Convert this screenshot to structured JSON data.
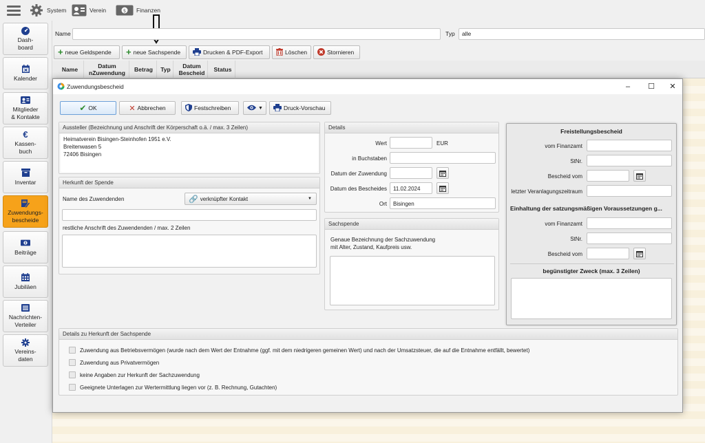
{
  "topbar": {
    "system": "System",
    "verein": "Verein",
    "finanzen": "Finanzen"
  },
  "sidebar": {
    "items": [
      {
        "label": "Dash-\nboard",
        "icon": "dashboard-icon"
      },
      {
        "label": "Kalender",
        "icon": "calendar-icon"
      },
      {
        "label": "Mitglieder\n& Kontakte",
        "icon": "contact-card-icon"
      },
      {
        "label": "Kassen-\nbuch",
        "icon": "euro-icon"
      },
      {
        "label": "Inventar",
        "icon": "inventory-icon"
      },
      {
        "label": "Zuwendungs-\nbescheide",
        "icon": "certificate-icon"
      },
      {
        "label": "Beiträge",
        "icon": "money-icon"
      },
      {
        "label": "Jubiläen",
        "icon": "calendar-grid-icon"
      },
      {
        "label": "Nachrichten-\nVerteiler",
        "icon": "mail-icon"
      },
      {
        "label": "Vereins-\ndaten",
        "icon": "gear-icon"
      }
    ],
    "active_index": 5
  },
  "filter": {
    "name_label": "Name",
    "name_value": "",
    "typ_label": "Typ",
    "typ_value": "alle"
  },
  "toolbar": {
    "neue_geldspende": "neue Geldspende",
    "neue_sachspende": "neue Sachspende",
    "drucken": "Drucken & PDF-Export",
    "loeschen": "Löschen",
    "stornieren": "Stornieren"
  },
  "table": {
    "headers": [
      "Name",
      "Datum nZuwendung",
      "Betrag",
      "Typ",
      "Datum Bescheid",
      "Status"
    ]
  },
  "dialog": {
    "title": "Zuwendungsbescheid",
    "buttons": {
      "ok": "OK",
      "abbrechen": "Abbrechen",
      "festschreiben": "Festschreiben",
      "druckvorschau": "Druck-Vorschau"
    },
    "aussteller": {
      "header": "Aussteller (Bezeichnung und Anschrift der Körperschaft o.ä. / max. 3 Zeilen)",
      "line1": "Heimatverein Bisingen-Steinhofen 1951 e.V.",
      "line2": "Breitenwasen 5",
      "line3": "72406 Bisingen"
    },
    "herkunft": {
      "header": "Herkunft der Spende",
      "name_label": "Name des Zuwendenden",
      "contact_button": "verknüpfter Kontakt",
      "name_value": "",
      "anschrift_label": "restliche Anschrift des Zuwendenden / max. 2 Zeilen",
      "anschrift_value": ""
    },
    "details": {
      "header": "Details",
      "wert_label": "Wert",
      "wert_value": "",
      "currency": "EUR",
      "buchstaben_label": "in Buchstaben",
      "buchstaben_value": "",
      "datum_zuwendung_label": "Datum der Zuwendung",
      "datum_zuwendung_value": "",
      "datum_bescheid_label": "Datum des Bescheides",
      "datum_bescheid_value": "11.02.2024",
      "ort_label": "Ort",
      "ort_value": "Bisingen"
    },
    "sachspende": {
      "header": "Sachspende",
      "desc1": "Genaue Bezeichnung der Sachzuwendung",
      "desc2": "mit Alter, Zustand, Kaufpreis usw.",
      "value": ""
    },
    "freistellung": {
      "header": "Freistellungsbescheid",
      "finanzamt_label": "vom Finanzamt",
      "stnr_label": "StNr.",
      "bescheid_label": "Bescheid vom",
      "zeitraum_label": "letzter Veranlagungszeitraum",
      "satzung_header": "Einhaltung der satzungsmäßigen Voraussetzungen g...",
      "finanzamt2_label": "vom Finanzamt",
      "stnr2_label": "StNr.",
      "bescheid2_label": "Bescheid vom",
      "zweck_header": "begünstigter Zweck (max. 3 Zeilen)"
    },
    "herkunft_sach": {
      "header": "Details zu Herkunft der Sachspende",
      "options": [
        "Zuwendung aus Betriebsvermögen (wurde nach dem Wert der Entnahme (ggf. mit dem niedrigeren gemeinen Wert) und nach der Umsatzsteuer, die auf die Entnahme entfällt, bewertet)",
        "Zuwendung aus Privatvermögen",
        "keine Angaben zur Herkunft der Sachzuwendung",
        "Geeignete Unterlagen zur Wertermittlung liegen vor (z. B. Rechnung, Gutachten)"
      ]
    }
  },
  "colors": {
    "active_sidebar": "#f6a21a",
    "green": "#2e8b2e",
    "red": "#c0392b",
    "blue": "#1f3f8f"
  }
}
